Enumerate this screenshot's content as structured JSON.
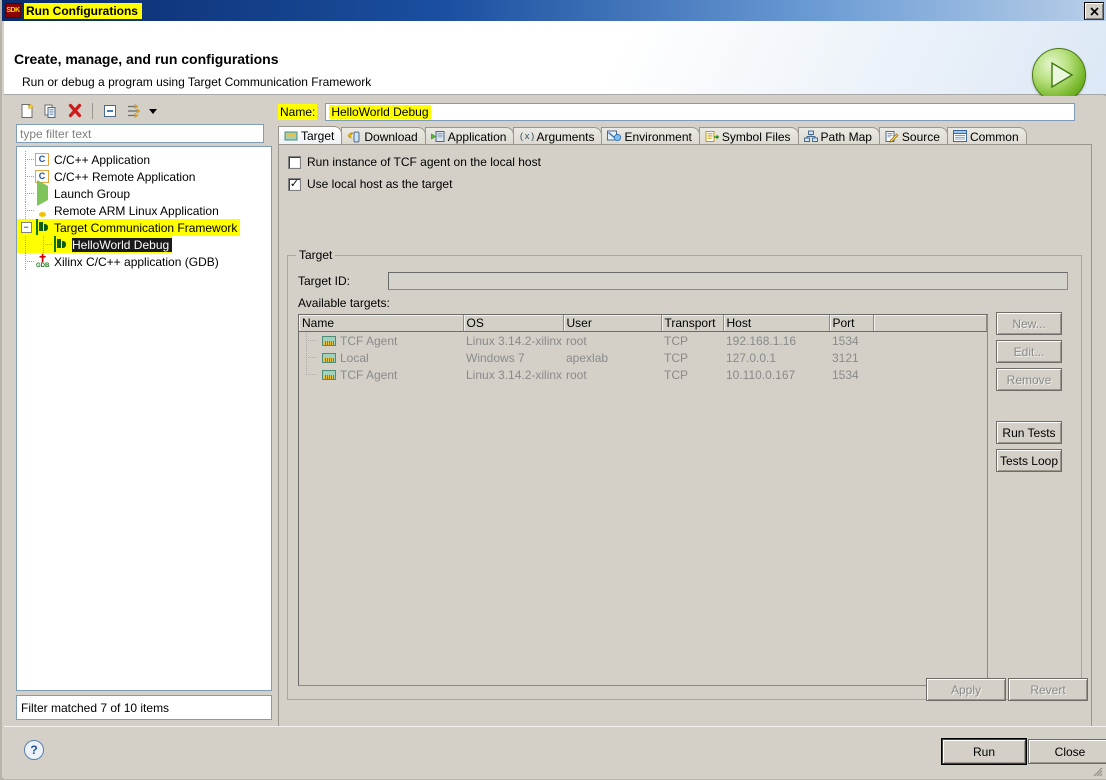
{
  "window": {
    "title": "Run Configurations",
    "app_icon": "sdk-icon",
    "close_label": "✕"
  },
  "header": {
    "title": "Create, manage, and run configurations",
    "subtitle": "Run or debug a program using Target Communication Framework",
    "badge_icon": "run-play-icon"
  },
  "left_panel": {
    "toolbar": [
      {
        "name": "new-launch-configuration-icon",
        "label": "New"
      },
      {
        "name": "duplicate-launch-configuration-icon",
        "label": "Duplicate"
      },
      {
        "name": "delete-launch-configuration-icon",
        "label": "Delete"
      },
      {
        "name": "collapse-all-icon",
        "label": "Collapse All"
      },
      {
        "name": "filter-launch-configurations-icon",
        "label": "Filter"
      }
    ],
    "filter": {
      "placeholder": "type filter text",
      "value": ""
    },
    "tree": [
      {
        "label": "C/C++ Application",
        "icon": "c-application-icon",
        "indent": 1,
        "highlight": false,
        "selected": false,
        "expander": ""
      },
      {
        "label": "C/C++ Remote Application",
        "icon": "c-application-icon",
        "indent": 1,
        "highlight": false,
        "selected": false,
        "expander": ""
      },
      {
        "label": "Launch Group",
        "icon": "launch-group-icon",
        "indent": 1,
        "highlight": false,
        "selected": false,
        "expander": ""
      },
      {
        "label": "Remote ARM Linux Application",
        "icon": "linux-icon",
        "indent": 1,
        "highlight": false,
        "selected": false,
        "expander": ""
      },
      {
        "label": "Target Communication Framework",
        "icon": "tcf-icon",
        "indent": 1,
        "highlight": true,
        "selected": false,
        "expander": "−"
      },
      {
        "label": "HelloWorld Debug",
        "icon": "tcf-icon",
        "indent": 2,
        "highlight": true,
        "selected": true,
        "expander": ""
      },
      {
        "label": "Xilinx C/C++ application (GDB)",
        "icon": "gdb-icon",
        "indent": 1,
        "highlight": false,
        "selected": false,
        "expander": ""
      }
    ],
    "status": "Filter matched 7 of 10 items"
  },
  "right_panel": {
    "name_label": "Name:",
    "name_value": "HelloWorld Debug",
    "tabs": [
      {
        "label": "Target",
        "icon": "target-chip-icon",
        "active": true
      },
      {
        "label": "Download",
        "icon": "download-icon",
        "active": false
      },
      {
        "label": "Application",
        "icon": "application-icon",
        "active": false
      },
      {
        "label": "Arguments",
        "icon": "arguments-icon",
        "active": false
      },
      {
        "label": "Environment",
        "icon": "environment-icon",
        "active": false
      },
      {
        "label": "Symbol Files",
        "icon": "symbol-files-icon",
        "active": false
      },
      {
        "label": "Path Map",
        "icon": "path-map-icon",
        "active": false
      },
      {
        "label": "Source",
        "icon": "source-icon",
        "active": false
      },
      {
        "label": "Common",
        "icon": "common-icon",
        "active": false
      }
    ],
    "checkboxes": [
      {
        "label": "Run instance of TCF agent on the local host",
        "checked": false
      },
      {
        "label": "Use local host as the target",
        "checked": true
      }
    ],
    "group": {
      "legend": "Target",
      "target_id_label": "Target ID:",
      "target_id_value": "",
      "available_label": "Available targets:",
      "columns": [
        "Name",
        "OS",
        "User",
        "Transport",
        "Host",
        "Port",
        ""
      ],
      "rows": [
        {
          "name": "TCF Agent",
          "os": "Linux 3.14.2-xilinx",
          "user": "root",
          "transport": "TCP",
          "host": "192.168.1.16",
          "port": "1534"
        },
        {
          "name": "Local",
          "os": "Windows 7",
          "user": "apexlab",
          "transport": "TCP",
          "host": "127.0.0.1",
          "port": "3121"
        },
        {
          "name": "TCF Agent",
          "os": "Linux 3.14.2-xilinx",
          "user": "root",
          "transport": "TCP",
          "host": "10.110.0.167",
          "port": "1534"
        }
      ],
      "side_buttons": [
        {
          "label": "New...",
          "enabled": false
        },
        {
          "label": "Edit...",
          "enabled": false
        },
        {
          "label": "Remove",
          "enabled": false
        },
        {
          "label": "Run Tests",
          "enabled": true
        },
        {
          "label": "Tests Loop",
          "enabled": true
        }
      ]
    },
    "apply_label": "Apply",
    "apply_enabled": false,
    "revert_label": "Revert",
    "revert_enabled": false
  },
  "footer": {
    "help_icon": "help-question-icon",
    "help_label": "?",
    "run_label": "Run",
    "close_label": "Close"
  },
  "colors": {
    "highlight": "#ffff00",
    "selection": "#1a1a1a",
    "titlebar_start": "#0a2a6b",
    "dialog_bg": "#d4d0c8",
    "field_border": "#7f9db9",
    "disabled_text": "#8a8a8a",
    "run_green": "#73b525"
  }
}
